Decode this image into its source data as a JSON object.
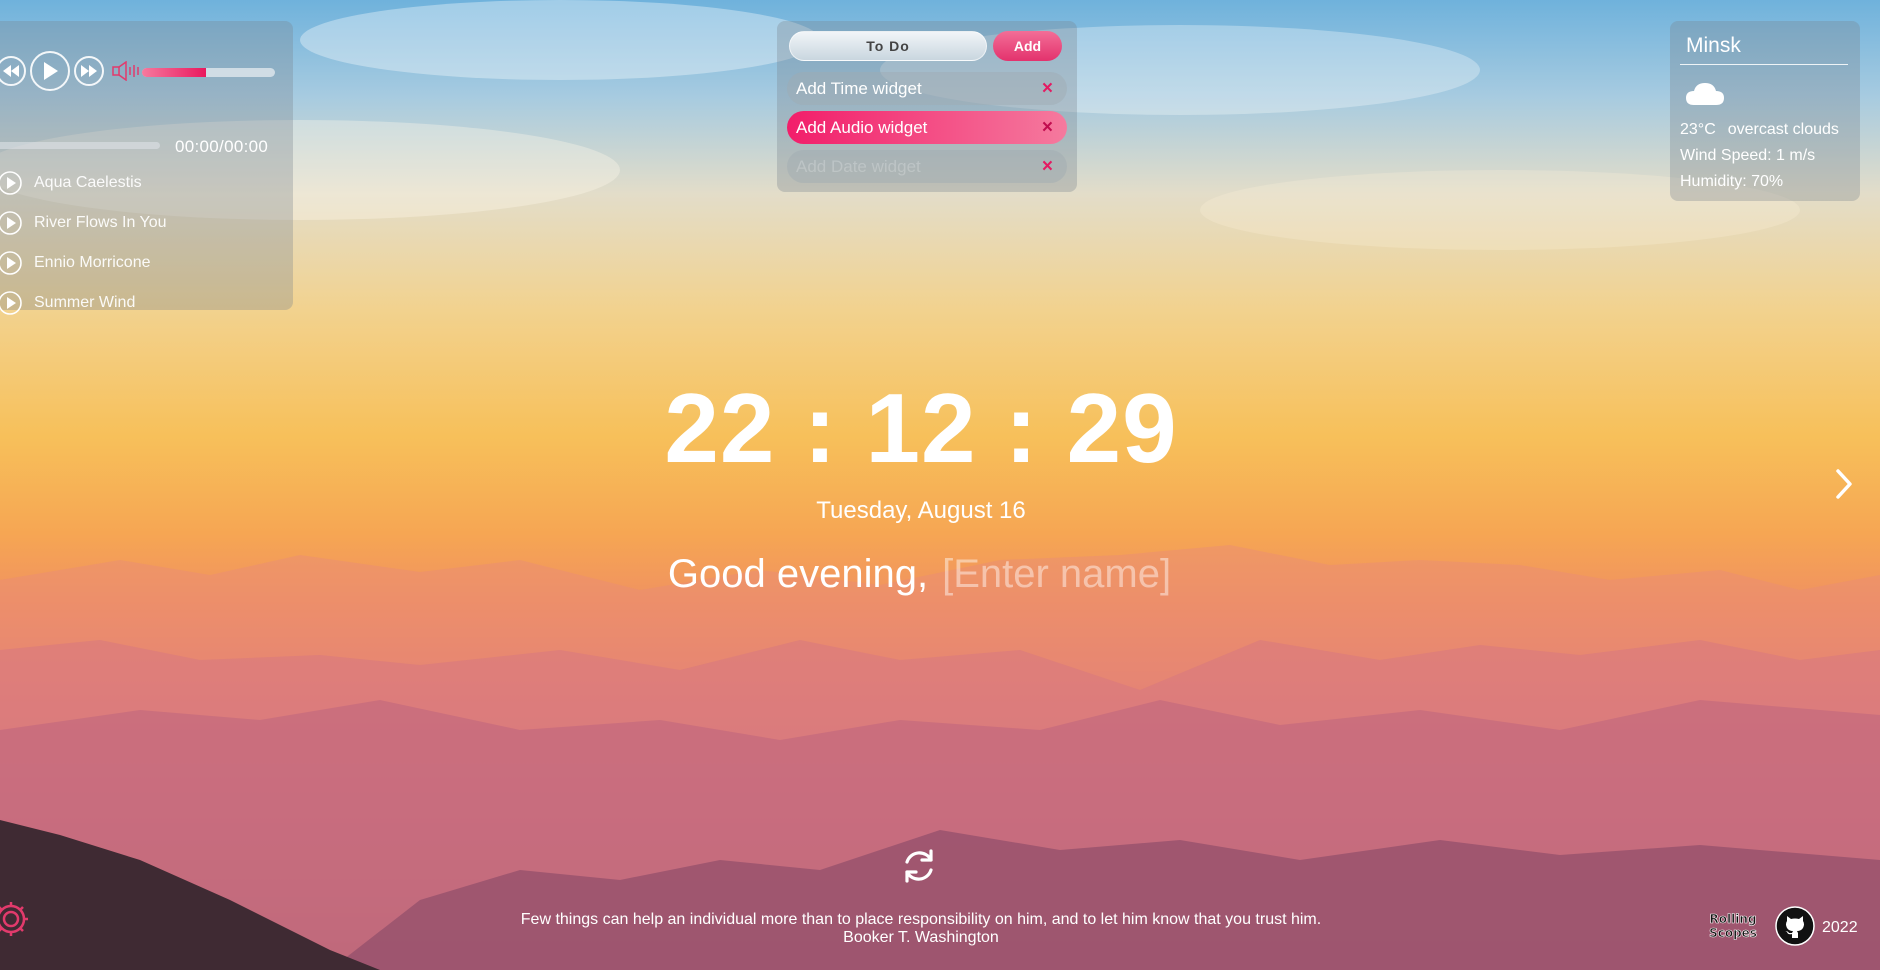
{
  "player": {
    "time_display": "00:00/00:00",
    "volume_level": 0.48,
    "accent_color": "#e9185e",
    "tracks": [
      {
        "title": "Aqua Caelestis"
      },
      {
        "title": "River Flows In You"
      },
      {
        "title": "Ennio Morricone"
      },
      {
        "title": "Summer Wind"
      }
    ]
  },
  "todo": {
    "header_label": "To Do",
    "add_label": "Add",
    "remove_glyph": "×",
    "items": [
      {
        "text": "Add Time widget",
        "state": "normal"
      },
      {
        "text": "Add Audio widget",
        "state": "active"
      },
      {
        "text": "Add Date widget",
        "state": "faded"
      }
    ]
  },
  "weather": {
    "city": "Minsk",
    "icon": "cloud-icon",
    "temperature": "23°C",
    "description": "overcast clouds",
    "wind": "Wind Speed: 1 m/s",
    "humidity": "Humidity: 70%"
  },
  "clock": {
    "time": "22 : 12 : 29",
    "date": "Tuesday, August 16"
  },
  "greeting": {
    "text": "Good evening,",
    "name_placeholder": "[Enter name]"
  },
  "quote": {
    "text": "Few things can help an individual more than to place responsibility on him, and to let him know that you trust him.",
    "author": "Booker T. Washington"
  },
  "footer": {
    "year": "2022",
    "school_logo_text": "The Rolling Scopes"
  }
}
